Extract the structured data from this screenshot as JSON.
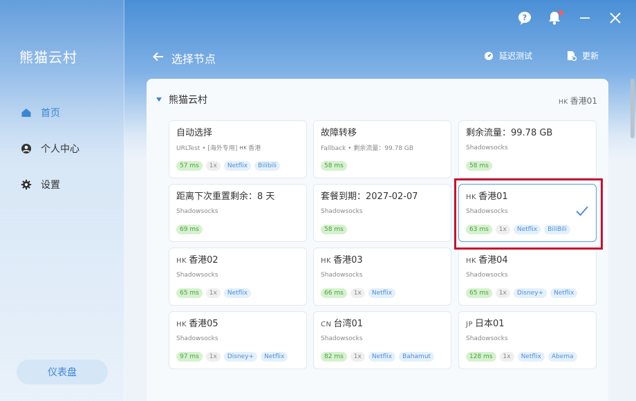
{
  "sidebar": {
    "brand": "熊猫云村",
    "items": [
      {
        "label": "首页",
        "icon": "home-icon",
        "active": true
      },
      {
        "label": "个人中心",
        "icon": "user-icon",
        "active": false
      },
      {
        "label": "设置",
        "icon": "gear-icon",
        "active": false
      }
    ],
    "dashboard_label": "仪表盘"
  },
  "header": {
    "title": "选择节点",
    "latency_test_label": "延迟测试",
    "update_label": "更新"
  },
  "group": {
    "name": "熊猫云村",
    "selected_flag": "HK",
    "selected_name": "香港01"
  },
  "cards": [
    {
      "flag": "",
      "title": "自动选择",
      "subtitle": "URLTest • [海外专用]",
      "sub_flag": "HK",
      "sub_tail": "香港",
      "latency": "57 ms",
      "mult": "1x",
      "tags": [
        "Netflix",
        "Bilibili"
      ]
    },
    {
      "flag": "",
      "title": "故障转移",
      "subtitle": "Fallback • 剩余流量：99.78 GB",
      "sub_flag": "",
      "sub_tail": "",
      "latency": "58 ms",
      "mult": "",
      "tags": []
    },
    {
      "flag": "",
      "title": "剩余流量：99.78 GB",
      "subtitle": "Shadowsocks",
      "sub_flag": "",
      "sub_tail": "",
      "latency": "58 ms",
      "mult": "",
      "tags": []
    },
    {
      "flag": "",
      "title": "距离下次重置剩余：8 天",
      "subtitle": "Shadowsocks",
      "sub_flag": "",
      "sub_tail": "",
      "latency": "69 ms",
      "mult": "",
      "tags": []
    },
    {
      "flag": "",
      "title": "套餐到期：2027-02-07",
      "subtitle": "Shadowsocks",
      "sub_flag": "",
      "sub_tail": "",
      "latency": "58 ms",
      "mult": "",
      "tags": []
    },
    {
      "flag": "HK",
      "title": "香港01",
      "subtitle": "Shadowsocks",
      "sub_flag": "",
      "sub_tail": "",
      "latency": "63 ms",
      "mult": "1x",
      "tags": [
        "Netflix",
        "BiliBili"
      ],
      "selected": true
    },
    {
      "flag": "HK",
      "title": "香港02",
      "subtitle": "Shadowsocks",
      "sub_flag": "",
      "sub_tail": "",
      "latency": "65 ms",
      "mult": "1x",
      "tags": [
        "Netflix"
      ]
    },
    {
      "flag": "HK",
      "title": "香港03",
      "subtitle": "Shadowsocks",
      "sub_flag": "",
      "sub_tail": "",
      "latency": "66 ms",
      "mult": "1x",
      "tags": [
        "Netflix"
      ]
    },
    {
      "flag": "HK",
      "title": "香港04",
      "subtitle": "Shadowsocks",
      "sub_flag": "",
      "sub_tail": "",
      "latency": "65 ms",
      "mult": "1x",
      "tags": [
        "Disney+",
        "Netflix"
      ]
    },
    {
      "flag": "HK",
      "title": "香港05",
      "subtitle": "Shadowsocks",
      "sub_flag": "",
      "sub_tail": "",
      "latency": "97 ms",
      "mult": "1x",
      "tags": [
        "Disney+",
        "Netflix"
      ]
    },
    {
      "flag": "CN",
      "title": "台湾01",
      "subtitle": "Shadowsocks",
      "sub_flag": "",
      "sub_tail": "",
      "latency": "82 ms",
      "mult": "1x",
      "tags": [
        "Netflix",
        "Bahamut"
      ]
    },
    {
      "flag": "JP",
      "title": "日本01",
      "subtitle": "Shadowsocks",
      "sub_flag": "",
      "sub_tail": "",
      "latency": "128 ms",
      "mult": "1x",
      "tags": [
        "Netflix",
        "Abema"
      ]
    }
  ],
  "colors": {
    "accent": "#3a86d4",
    "latency_bg": "#d6f1cf",
    "latency_text": "#43a53a",
    "tag_bg": "#e4f0fb",
    "tag_text": "#4a90d9",
    "highlight_box": "#c8102e"
  }
}
